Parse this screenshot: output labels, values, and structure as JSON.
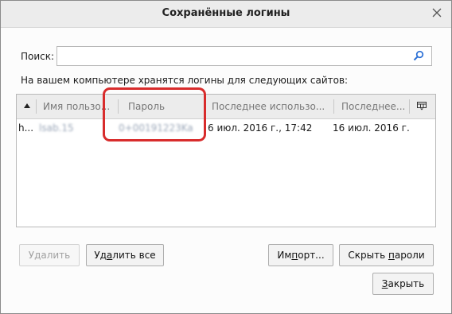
{
  "window": {
    "title": "Сохранённые логины",
    "close_icon": "close-icon"
  },
  "search": {
    "label": "Поиск:",
    "value": "",
    "icon": "search-icon"
  },
  "info_text": "На вашем компьютере хранятся логины для следующих сайтов:",
  "table": {
    "columns": [
      {
        "label": "Имя пользо..."
      },
      {
        "label": "Пароль"
      },
      {
        "label": "Последнее использо..."
      },
      {
        "label": "Последнее..."
      }
    ],
    "rows": [
      {
        "site": "h...",
        "username": "lsab.15",
        "password": "0+00191223Ka",
        "last_used": "6 июл. 2016 г., 17:42",
        "last_changed": "16 июл. 2016 г."
      }
    ]
  },
  "buttons": {
    "delete": {
      "pre": "У",
      "key": "д",
      "post": "алить"
    },
    "delete_all": {
      "pre": "Уд",
      "key": "а",
      "post": "лить все"
    },
    "import": {
      "pre": "Им",
      "key": "п",
      "post": "орт..."
    },
    "hide_passwords": {
      "pre": "Скрыть ",
      "key": "п",
      "post": "ароли"
    },
    "close": {
      "pre": "",
      "key": "З",
      "post": "акрыть"
    }
  },
  "colors": {
    "highlight": "#d82c2c",
    "dialog_bg": "#fcfcfc",
    "header_bg": "#ececec"
  }
}
